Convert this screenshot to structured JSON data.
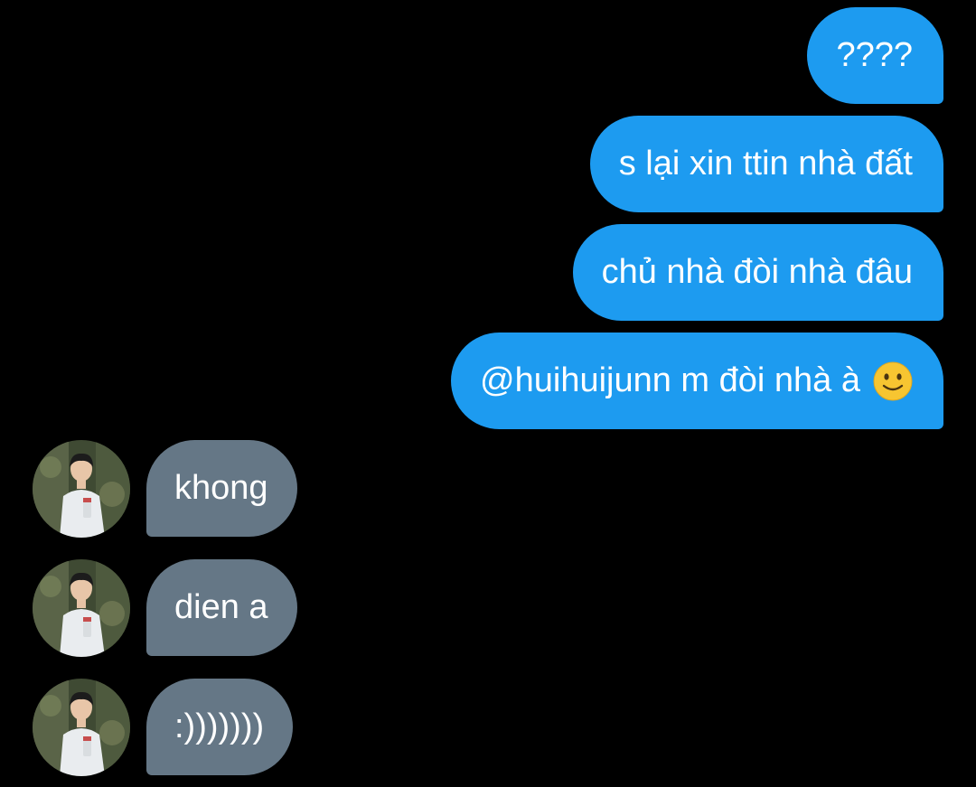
{
  "conversation": {
    "outgoing": [
      {
        "text": "????"
      },
      {
        "text": "s lại xin ttin nhà đất"
      },
      {
        "text": "chủ nhà đòi nhà đâu"
      },
      {
        "text": "@huihuijunn m đòi nhà à",
        "emoji": "slightly-smiling-face-icon"
      }
    ],
    "incoming": [
      {
        "text": "khong",
        "avatar": "user-avatar"
      },
      {
        "text": "dien a",
        "avatar": "user-avatar"
      },
      {
        "text": ":)))))))",
        "avatar": "user-avatar"
      }
    ]
  },
  "colors": {
    "background": "#000000",
    "outgoing_bubble": "#1d9bf0",
    "incoming_bubble": "#657786",
    "text": "#ffffff"
  }
}
